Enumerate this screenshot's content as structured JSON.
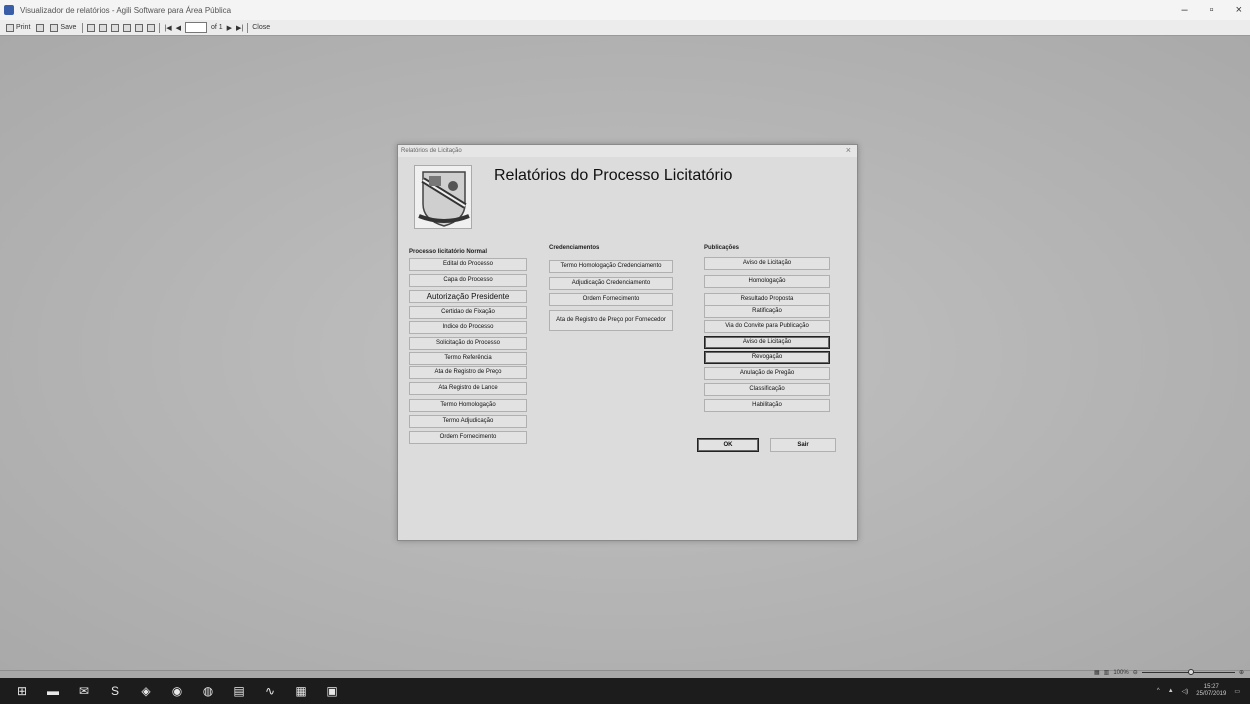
{
  "window": {
    "title": "Visualizador de relatórios - Agili Software para Área Pública",
    "minimize": "–",
    "maximize": "▫",
    "close": "×"
  },
  "toolbar": {
    "print_label": "Print",
    "save_label": "Save",
    "page_value": "",
    "page_of": "of 1",
    "close_label": "Close"
  },
  "dialog": {
    "title": "Relatórios de Licitação",
    "close": "×",
    "heading": "Relatórios do Processo Licitatório",
    "col1_title": "Processo licitatório Normal",
    "col1_buttons": [
      "Edital do Processo",
      "Capa do Processo",
      "Autorização Presidente",
      "Certidao de Fixação",
      "Indice do Processo",
      "Solicitação do Processo",
      "Termo Referência",
      "Ata de Registro de Preço",
      "Ata Registro de Lance",
      "Termo Homologação",
      "Termo Adjudicação",
      "Ordem Fornecimento"
    ],
    "col2_title": "Credenciamentos",
    "col2_buttons": [
      "Termo Homologação Credenciamento",
      "Adjudicação Credenciamento",
      "Ordem Fornecimento",
      "Ata de Registro de Preço por Fornecedor"
    ],
    "col3_title": "Publicações",
    "col3_buttons": [
      "Aviso de Licitação",
      "Homologação",
      "Resultado Proposta",
      "Ratificação",
      "Via do Convite para Publicação",
      "Aviso de Licitação",
      "Revogação",
      "Anulação de Pregão",
      "Classificação",
      "Habilitação"
    ],
    "ok_label": "OK",
    "exit_label": "Sair"
  },
  "statusbar": {
    "zoom_value": "100%"
  },
  "taskbar": {
    "time": "15:27",
    "date": "25/07/2019"
  }
}
